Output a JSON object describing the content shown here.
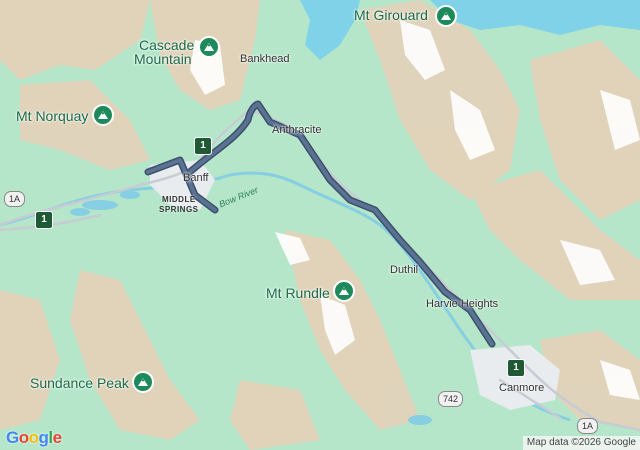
{
  "peaks": [
    {
      "name": "Mt Girouard"
    },
    {
      "name_line1": "Cascade",
      "name_line2": "Mountain"
    },
    {
      "name": "Mt Norquay"
    },
    {
      "name": "Mt Rundle"
    },
    {
      "name": "Sundance Peak"
    }
  ],
  "places": {
    "bankhead": "Bankhead",
    "anthracite": "Anthracite",
    "banff": "Banff",
    "middle_springs_1": "MIDDLE",
    "middle_springs_2": "SPRINGS",
    "duthil": "Duthil",
    "harvie_heights": "Harvie Heights",
    "canmore": "Canmore"
  },
  "water": {
    "bow_river": "Bow River"
  },
  "roads": {
    "hwy1": "1",
    "hwy1a": "1A",
    "route742": "742"
  },
  "route": {
    "color": "#4e6685",
    "outline": "#3b4f6b"
  },
  "branding": {
    "logo": "Google",
    "attribution": "Map data ©2026 Google"
  },
  "colors": {
    "land": "#b5e6c9",
    "rock": "#e4d3bb",
    "snow": "#ffffff",
    "water": "#7dd1e8",
    "urban": "#e8ecef",
    "peak_pin": "#1d8a5b",
    "highway_shield": "#1f5a34"
  }
}
